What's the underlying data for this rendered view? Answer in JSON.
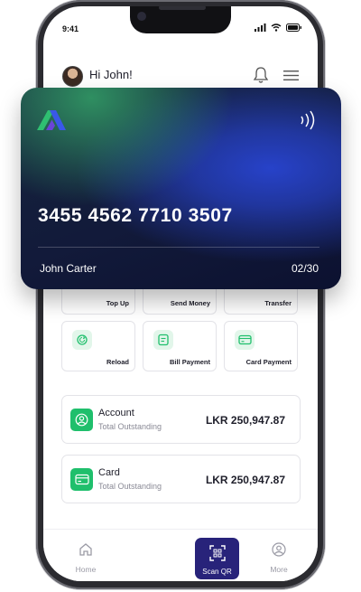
{
  "status_bar": {
    "time": "9:41"
  },
  "header": {
    "greeting": "Hi John!"
  },
  "card": {
    "number": "3455 4562 7710 3507",
    "holder": "John Carter",
    "expiry": "02/30"
  },
  "actions_top": [
    {
      "label": "Top Up"
    },
    {
      "label": "Send Money"
    },
    {
      "label": "Transfer"
    }
  ],
  "actions": [
    {
      "label": "Reload",
      "icon": "reload-icon"
    },
    {
      "label": "Bill Payment",
      "icon": "bill-icon"
    },
    {
      "label": "Card Payment",
      "icon": "card-payment-icon"
    }
  ],
  "accounts": [
    {
      "title": "Account",
      "subtitle": "Total Outstanding",
      "amount": "LKR 250,947.87",
      "icon": "user-icon"
    },
    {
      "title": "Card",
      "subtitle": "Total Outstanding",
      "amount": "LKR 250,947.87",
      "icon": "card-icon"
    }
  ],
  "nav": {
    "home": "Home",
    "scan": "Scan QR",
    "more": "More"
  },
  "colors": {
    "accent_green": "#1fbf6c",
    "scan_button": "#28237a",
    "card_blue": "#2742c9"
  }
}
